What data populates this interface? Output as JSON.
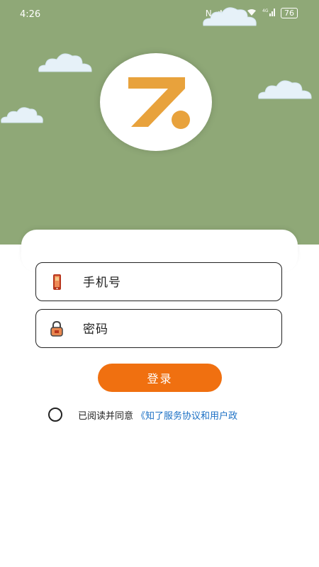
{
  "status_bar": {
    "time": "4:26",
    "battery": "76",
    "icons": [
      "nfc-icon",
      "bluetooth-icon",
      "mute-icon",
      "wifi-icon",
      "signal-4g-icon",
      "battery-icon"
    ]
  },
  "header": {
    "background_color": "#8fa877",
    "logo": {
      "letter": "Z",
      "color": "#e8a23c"
    }
  },
  "form": {
    "phone_placeholder": "手机号",
    "password_placeholder": "密码",
    "login_label": "登录"
  },
  "agreement": {
    "text": "已阅读并同意",
    "link": "《知了服务协议和用户政"
  },
  "colors": {
    "accent": "#f07010",
    "link": "#1a6fc4"
  }
}
